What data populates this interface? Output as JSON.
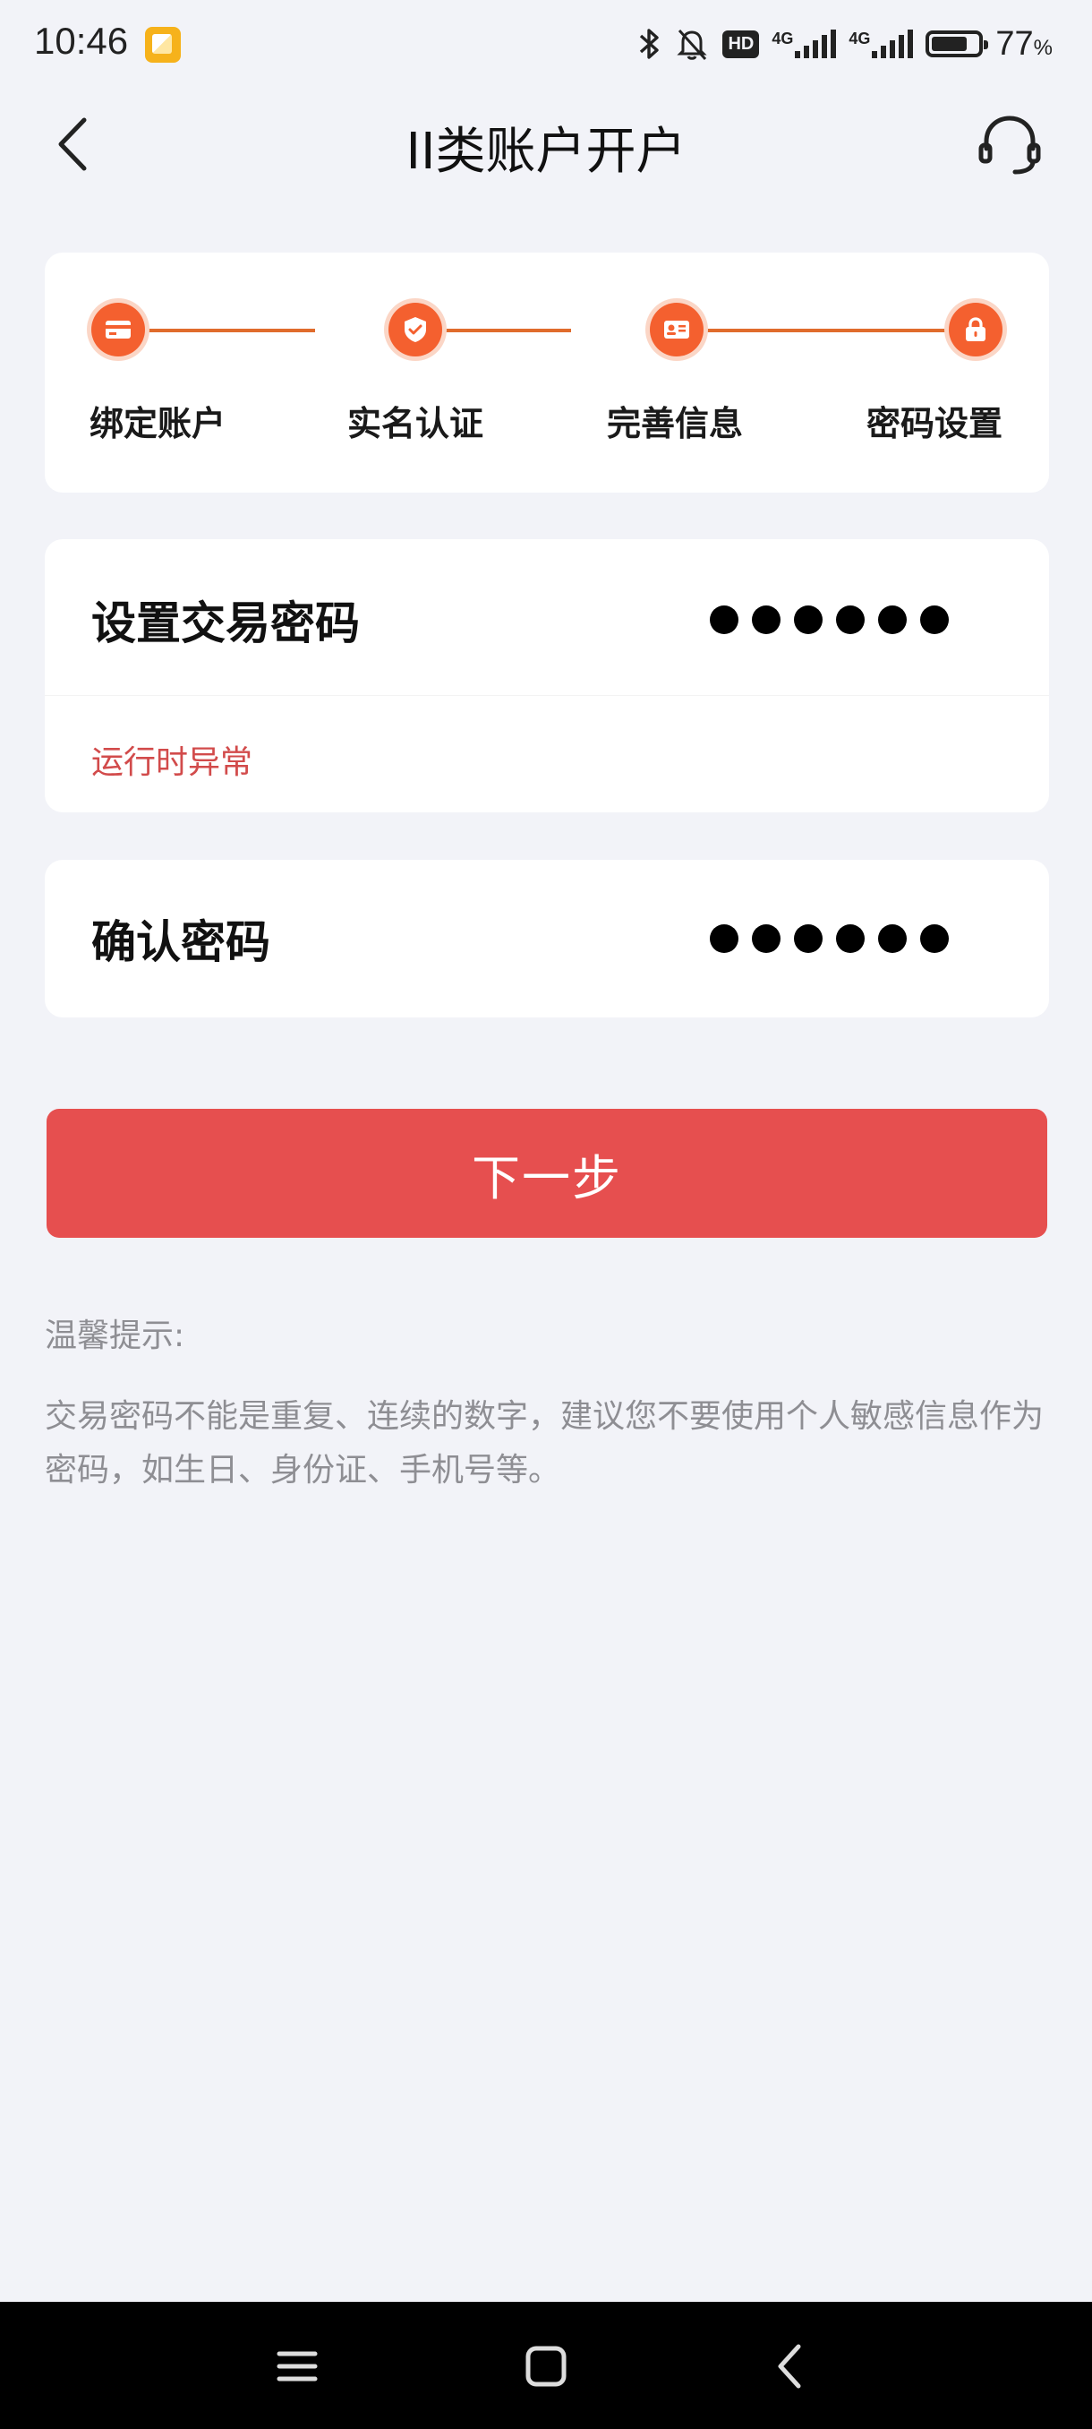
{
  "status_bar": {
    "time": "10:46",
    "hd_label": "HD",
    "network_1": "4G",
    "network_2": "4G",
    "battery_percent": 77,
    "battery_text": "77",
    "battery_unit": "%"
  },
  "nav": {
    "title": "II类账户开户"
  },
  "steps": [
    {
      "label": "绑定账户"
    },
    {
      "label": "实名认证"
    },
    {
      "label": "完善信息"
    },
    {
      "label": "密码设置"
    }
  ],
  "form": {
    "password_label": "设置交易密码",
    "password_error": "运行时异常",
    "confirm_label": "确认密码"
  },
  "next_button_label": "下一步",
  "tips": {
    "title": "温馨提示:",
    "body": "交易密码不能是重复、连续的数字，建议您不要使用个人敏感信息作为密码，如生日、身份证、手机号等。"
  },
  "colors": {
    "accent": "#f4602f",
    "button": "#e64f4f",
    "error": "#d24b4b"
  }
}
